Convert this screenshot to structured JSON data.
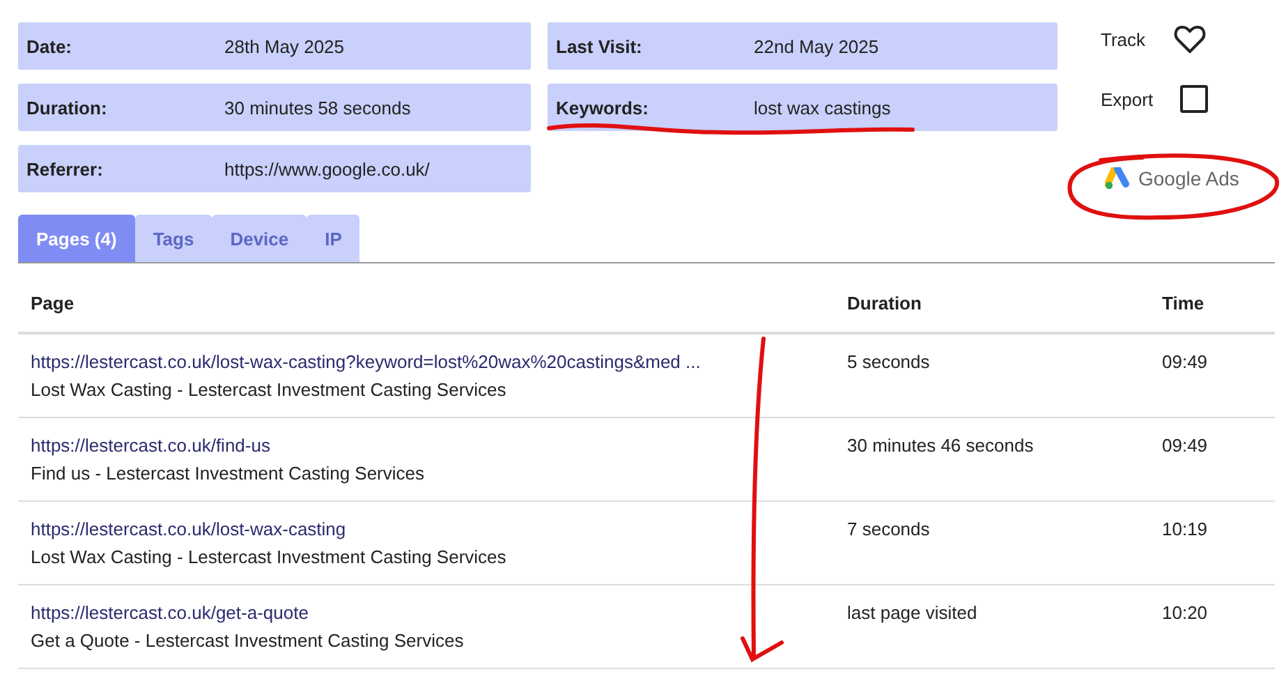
{
  "details": [
    {
      "label": "Date:",
      "value": "28th May 2025"
    },
    {
      "label": "Last Visit:",
      "value": "22nd May 2025"
    },
    {
      "label": "Duration:",
      "value": "30 minutes 58 seconds"
    },
    {
      "label": "Keywords:",
      "value": "lost wax castings"
    },
    {
      "label": "Referrer:",
      "value": "https://www.google.co.uk/"
    }
  ],
  "actions": {
    "track": {
      "label": "Track",
      "on": false
    },
    "export": {
      "label": "Export",
      "checked": false
    },
    "source": {
      "label": "Google Ads"
    }
  },
  "tabs": [
    {
      "label": "Pages (4)",
      "selected": true
    },
    {
      "label": "Tags",
      "selected": false
    },
    {
      "label": "Device",
      "selected": false
    },
    {
      "label": "IP",
      "selected": false
    }
  ],
  "table": {
    "columns": [
      "Page",
      "Duration",
      "Time"
    ],
    "rows": [
      {
        "url": "https://lestercast.co.uk/lost-wax-casting?keyword=lost%20wax%20castings&med ...",
        "title": "Lost Wax Casting - Lestercast Investment Casting Services",
        "duration": "5 seconds",
        "time": "09:49"
      },
      {
        "url": "https://lestercast.co.uk/find-us",
        "title": "Find us - Lestercast Investment Casting Services",
        "duration": "30 minutes 46 seconds",
        "time": "09:49"
      },
      {
        "url": "https://lestercast.co.uk/lost-wax-casting",
        "title": "Lost Wax Casting - Lestercast Investment Casting Services",
        "duration": "7 seconds",
        "time": "10:19"
      },
      {
        "url": "https://lestercast.co.uk/get-a-quote",
        "title": "Get a Quote - Lestercast Investment Casting Services",
        "duration": "last page visited",
        "time": "10:20"
      }
    ]
  }
}
